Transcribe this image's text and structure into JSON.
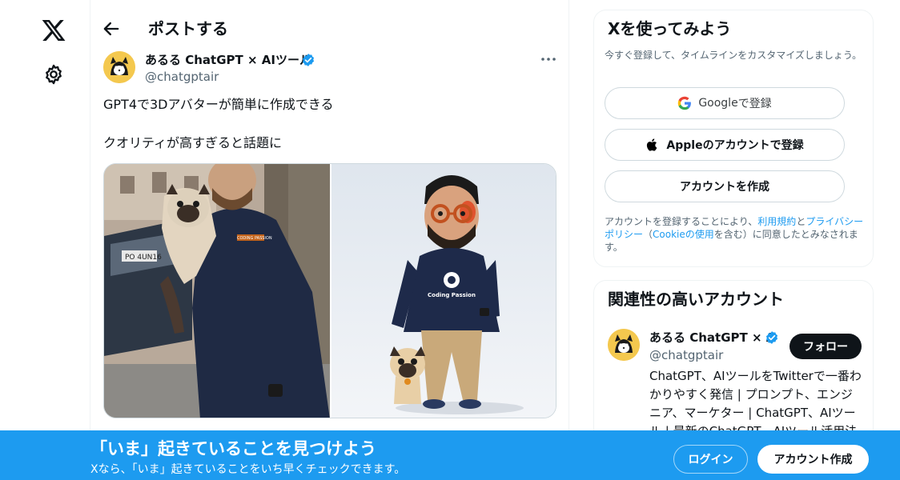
{
  "header": {
    "title": "ポストする"
  },
  "post": {
    "author_name": "あるる ChatGPT × AIツール",
    "author_handle": "@chatgptair",
    "text_line_1": "GPT4で3Dアバターが簡単に作成できる",
    "text_line_2": "クオリティが高すぎると話題に",
    "media_labels": {
      "hoodie_brand_left": "CODING PASSION",
      "hoodie_brand_right": "Coding Passion",
      "license_plate": "PO 4UN16"
    }
  },
  "signup": {
    "title": "Xを使ってみよう",
    "subtitle": "今すぐ登録して、タイムラインをカスタマイズしましょう。",
    "google_brand": "Google",
    "google_suffix": " で登録",
    "apple_label": "Appleのアカウントで登録",
    "create_label": "アカウントを作成",
    "terms_prefix": "アカウントを登録することにより、",
    "terms_link": "利用規約",
    "terms_and": "と",
    "privacy_link": "プライバシーポリシー",
    "terms_paren_open": "（",
    "cookie_link": "Cookieの使用",
    "terms_suffix": "を含む）に同意したとみなされます。"
  },
  "related": {
    "title": "関連性の高いアカウント",
    "account_name": "あるる ChatGPT × A",
    "account_handle": "@chatgptair",
    "follow_label": "フォロー",
    "bio": "ChatGPT、AIツールをTwitterで一番わかりやすく発信 | プロンプト、エンジニア、マーケター | ChatGPT、AIツール | 最新のChatGPT、AIツール活用法が学"
  },
  "banner": {
    "title": "「いま」起きていることを見つけよう",
    "subtitle": "Xなら、「いま」起きていることをいち早くチェックできます。",
    "login_label": "ログイン",
    "create_label": "アカウント作成"
  },
  "colors": {
    "accent": "#1d9bf0",
    "text": "#0f1419",
    "muted": "#536471",
    "border": "#eff3f4"
  }
}
